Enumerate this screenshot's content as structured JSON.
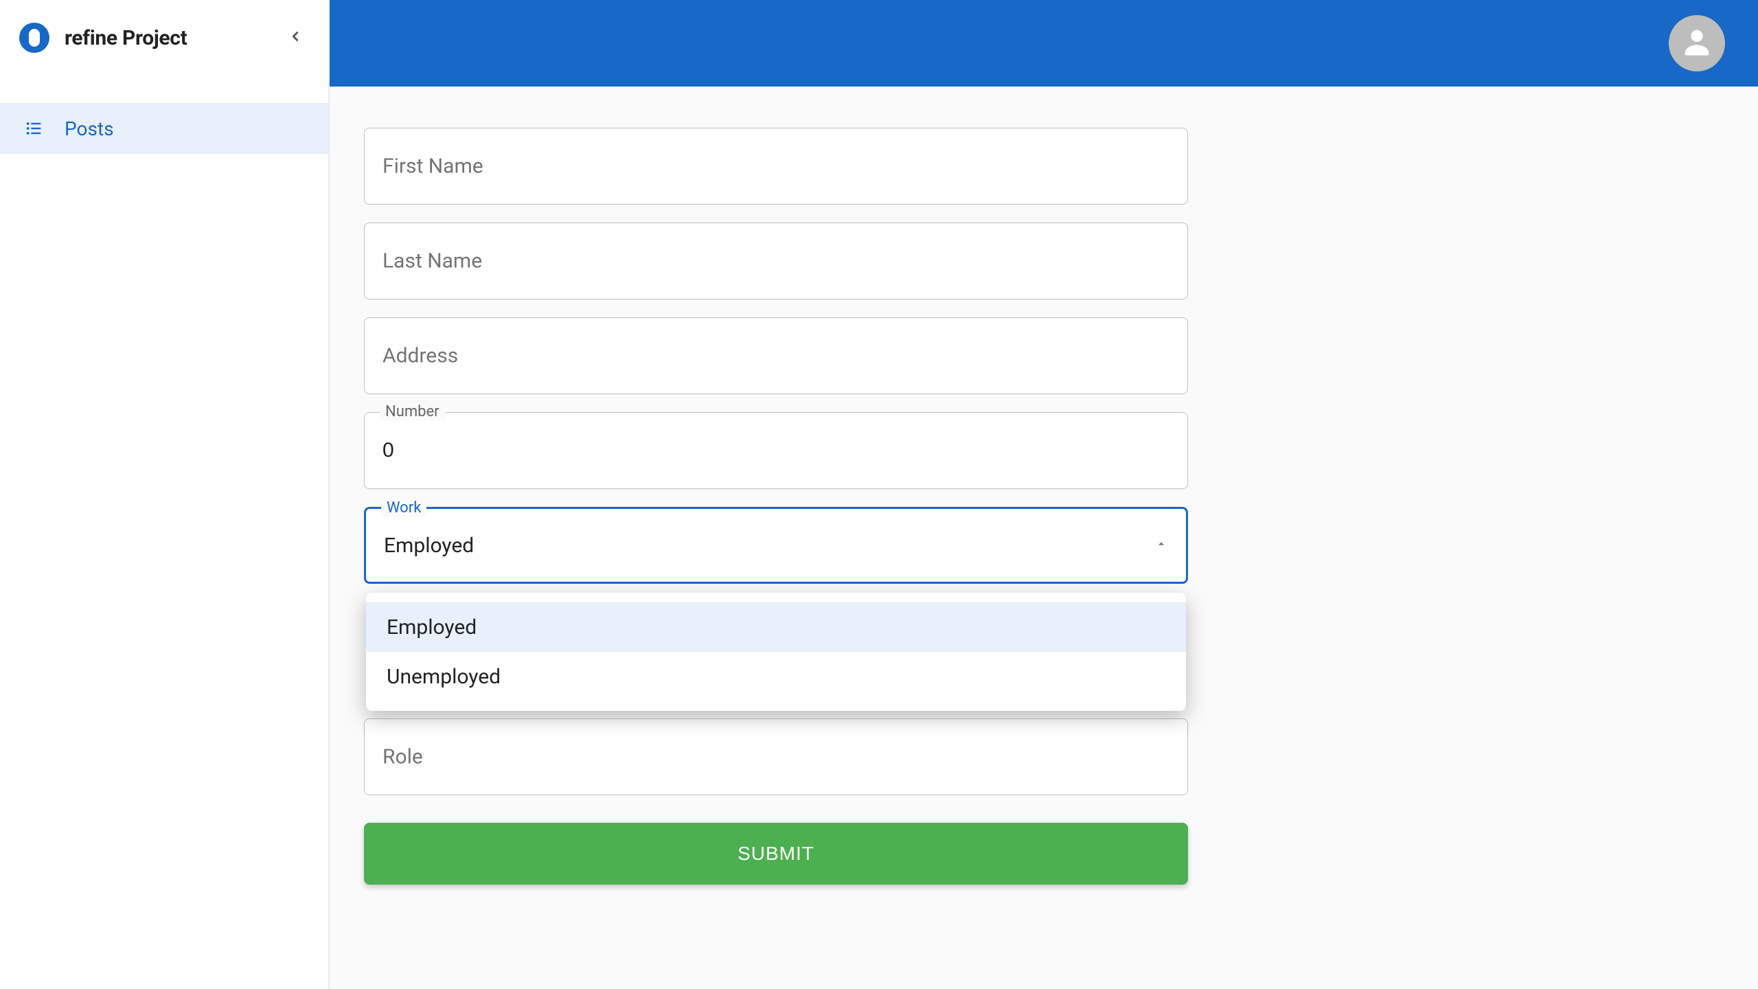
{
  "sidebar": {
    "title": "refine Project",
    "items": [
      {
        "label": "Posts"
      }
    ]
  },
  "form": {
    "first_name": {
      "label": "First Name",
      "value": ""
    },
    "last_name": {
      "label": "Last Name",
      "value": ""
    },
    "address": {
      "label": "Address",
      "value": ""
    },
    "number": {
      "label": "Number",
      "value": "0"
    },
    "work": {
      "label": "Work",
      "value": "Employed",
      "options": [
        "Employed",
        "Unemployed"
      ]
    },
    "role": {
      "label": "Role",
      "value": ""
    },
    "submit_label": "SUBMIT"
  }
}
